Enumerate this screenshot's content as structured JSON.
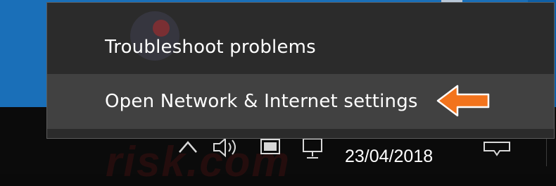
{
  "menu": {
    "items": [
      {
        "label": "Troubleshoot problems"
      },
      {
        "label": "Open Network & Internet settings"
      }
    ]
  },
  "taskbar": {
    "date": "23/04/2018",
    "icons": [
      "chevron-up-icon",
      "volume-icon",
      "battery-icon",
      "network-icon",
      "action-center-icon"
    ]
  },
  "colors": {
    "menu_bg": "#2b2b2b",
    "highlight_bg": "#414141",
    "arrow": "#f2731c",
    "desktop": "#1a6fb8"
  }
}
